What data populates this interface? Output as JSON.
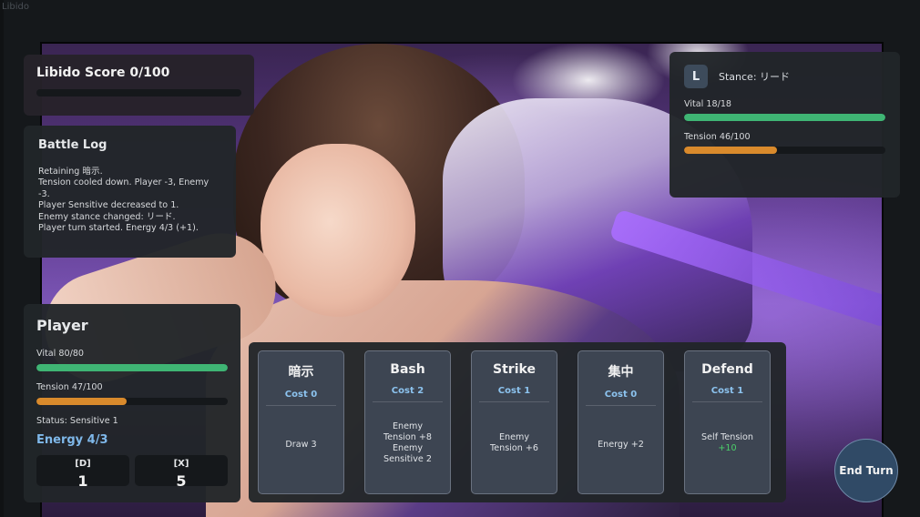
{
  "window": {
    "title": "Libido"
  },
  "libido": {
    "label": "Libido Score 0/100",
    "value": 0,
    "max": 100
  },
  "battle_log": {
    "title": "Battle Log",
    "lines": [
      "Retaining 暗示.",
      "Tension cooled down. Player -3, Enemy",
      "-3.",
      "Player Sensitive decreased to 1.",
      "Enemy stance changed: リード.",
      "Player turn started. Energy 4/3 (+1)."
    ]
  },
  "enemy": {
    "badge": "L",
    "stance": "Stance: リード",
    "vital_label": "Vital 18/18",
    "vital": 1.0,
    "tension_label": "Tension 46/100",
    "tension": 0.46
  },
  "player": {
    "title": "Player",
    "vital_label": "Vital 80/80",
    "vital": 1.0,
    "tension_label": "Tension 47/100",
    "tension": 0.47,
    "status": "Status: Sensitive 1",
    "energy": "Energy 4/3",
    "piles": [
      {
        "key": "[D]",
        "count": "1"
      },
      {
        "key": "[X]",
        "count": "5"
      }
    ]
  },
  "hand": [
    {
      "name": "暗示",
      "cost": "Cost 0",
      "effect": [
        "Draw 3"
      ]
    },
    {
      "name": "Bash",
      "cost": "Cost 2",
      "effect": [
        "Enemy",
        "Tension +8",
        "Enemy",
        "Sensitive 2"
      ]
    },
    {
      "name": "Strike",
      "cost": "Cost 1",
      "effect": [
        "Enemy",
        "Tension +6"
      ]
    },
    {
      "name": "集中",
      "cost": "Cost 0",
      "effect": [
        "Energy +2"
      ]
    },
    {
      "name": "Defend",
      "cost": "Cost 1",
      "effect": [
        "Self Tension"
      ],
      "effect_highlight": "+10"
    }
  ],
  "end_turn": {
    "label": "End Turn"
  },
  "colors": {
    "vital": "#3fb574",
    "tension": "#d98a2c",
    "energy": "#7fb8ea",
    "accent_green": "#4cd06a"
  }
}
